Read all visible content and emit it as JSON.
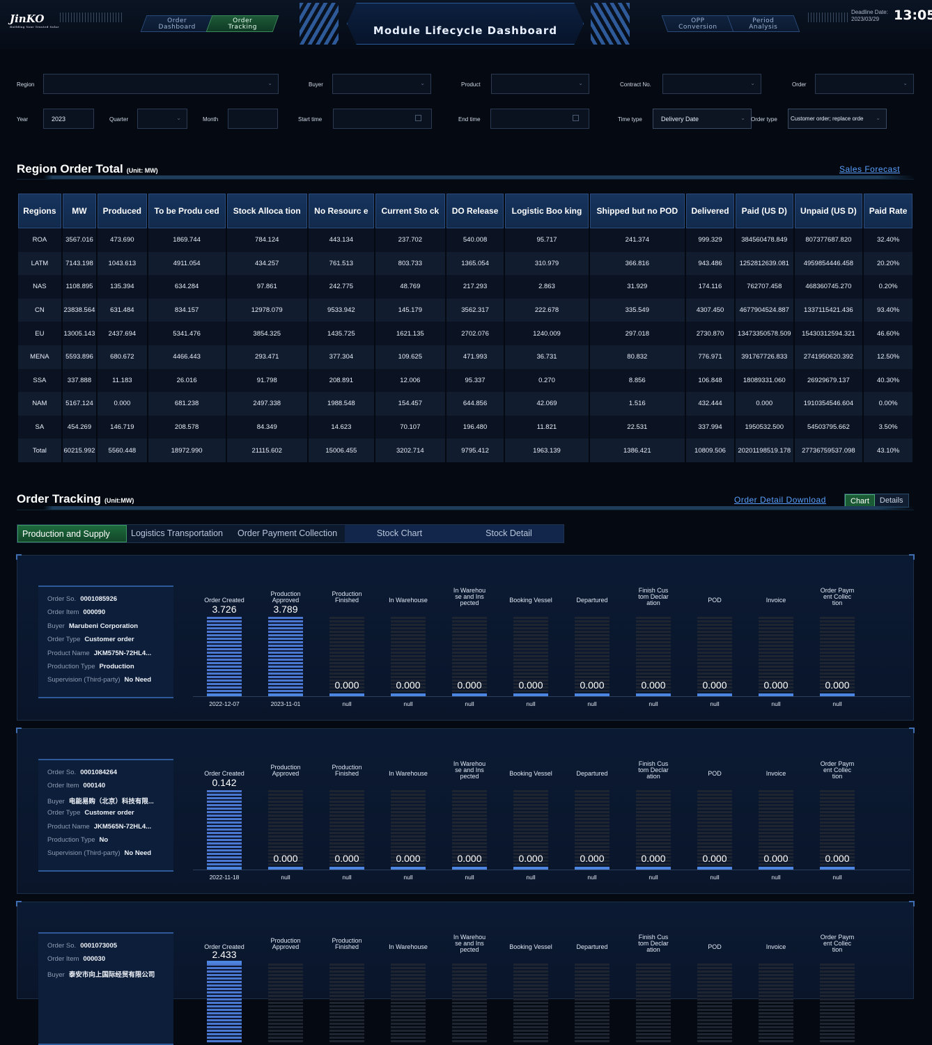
{
  "header": {
    "logo": "JinKO",
    "logo_sub": "Solar",
    "logo_tag": "Building Your Trusted Solar",
    "nav_left": [
      {
        "label": "Order\nDashboard"
      },
      {
        "label": "Order\nTracking"
      }
    ],
    "title": "Module Lifecycle Dashboard",
    "nav_right": [
      {
        "label": "OPP\nConversion"
      },
      {
        "label": "Period\nAnalysis"
      }
    ],
    "deadline_label": "Deadline Date:",
    "deadline_date": "2023/03/29",
    "clock": "13:05"
  },
  "filters": {
    "region_label": "Region",
    "buyer_label": "Buyer",
    "product_label": "Product",
    "contract_label": "Contract No.",
    "order_label": "Order",
    "year_label": "Year",
    "year_value": "2023",
    "quarter_label": "Quarter",
    "month_label": "Month",
    "start_label": "Start time",
    "end_label": "End time",
    "time_type_label": "Time type",
    "time_type_value": "Delivery Date",
    "order_type_label": "Order type",
    "order_type_value": "Customer order; replace orde"
  },
  "region_section": {
    "title": "Region Order Total",
    "unit": "(Unit: MW)",
    "link": "Sales Forecast"
  },
  "region_table": {
    "headers": [
      "Regions",
      "MW",
      "Produced",
      "To be Produ ced",
      "Stock Alloca tion",
      "No Resourc e",
      "Current Sto ck",
      "DO Release",
      "Logistic Boo king",
      "Shipped but no POD",
      "Delivered",
      "Paid  (US D)",
      "Unpaid  (US D)",
      "Paid Rate"
    ],
    "rows": [
      [
        "ROA",
        "3567.016",
        "473.690",
        "1869.744",
        "784.124",
        "443.134",
        "237.702",
        "540.008",
        "95.717",
        "241.374",
        "999.329",
        "384560478.849",
        "807377687.820",
        "32.40%"
      ],
      [
        "LATM",
        "7143.198",
        "1043.613",
        "4911.054",
        "434.257",
        "761.513",
        "803.733",
        "1365.054",
        "310.979",
        "366.816",
        "943.486",
        "1252812639.081",
        "4959854446.458",
        "20.20%"
      ],
      [
        "NAS",
        "1108.895",
        "135.394",
        "634.284",
        "97.861",
        "242.775",
        "48.769",
        "217.293",
        "2.863",
        "31.929",
        "174.116",
        "762707.458",
        "468360745.270",
        "0.20%"
      ],
      [
        "CN",
        "23838.564",
        "631.484",
        "834.157",
        "12978.079",
        "9533.942",
        "145.179",
        "3562.317",
        "222.678",
        "335.549",
        "4307.450",
        "4677904524.887",
        "1337115421.436",
        "93.40%"
      ],
      [
        "EU",
        "13005.143",
        "2437.694",
        "5341.476",
        "3854.325",
        "1435.725",
        "1621.135",
        "2702.076",
        "1240.009",
        "297.018",
        "2730.870",
        "13473350578.509",
        "15430312594.321",
        "46.60%"
      ],
      [
        "MENA",
        "5593.896",
        "680.672",
        "4466.443",
        "293.471",
        "377.304",
        "109.625",
        "471.993",
        "36.731",
        "80.832",
        "776.971",
        "391767726.833",
        "2741950620.392",
        "12.50%"
      ],
      [
        "SSA",
        "337.888",
        "11.183",
        "26.016",
        "91.798",
        "208.891",
        "12.006",
        "95.337",
        "0.270",
        "8.856",
        "106.848",
        "18089331.060",
        "26929679.137",
        "40.30%"
      ],
      [
        "NAM",
        "5167.124",
        "0.000",
        "681.238",
        "2497.338",
        "1988.548",
        "154.457",
        "644.856",
        "42.069",
        "1.516",
        "432.444",
        "0.000",
        "1910354546.604",
        "0.00%"
      ],
      [
        "SA",
        "454.269",
        "146.719",
        "208.578",
        "84.349",
        "14.623",
        "70.107",
        "196.480",
        "11.821",
        "22.531",
        "337.994",
        "1950532.500",
        "54503795.662",
        "3.50%"
      ],
      [
        "Total",
        "60215.992",
        "5560.448",
        "18972.990",
        "21115.602",
        "15006.455",
        "3202.714",
        "9795.412",
        "1963.139",
        "1386.421",
        "10809.506",
        "20201198519.178",
        "27736759537.098",
        "43.10%"
      ]
    ]
  },
  "tracking_section": {
    "title": "Order Tracking",
    "unit": "(Unit:MW)",
    "link": "Order Detail Download",
    "toggle": [
      "Chart",
      "Details"
    ]
  },
  "tracking_tabs": [
    "Production and Supply",
    "Logistics Transportation",
    "Order Payment Collection",
    "Stock Chart",
    "Stock Detail"
  ],
  "stage_labels": [
    "Order Created",
    "Production\nApproved",
    "Production\nFinished",
    "In Warehouse",
    "In Warehou\nse and Ins\npected",
    "Booking Vessel",
    "Departured",
    "Finish Cus\ntom Declar\nation",
    "POD",
    "Invoice",
    "Order Paym\nent Collec\ntion"
  ],
  "info_keys": [
    "Order So.",
    "Order Item",
    "Buyer",
    "Order Type",
    "Product Name",
    "Production Type",
    "Supervision (Third-party)"
  ],
  "orders": [
    {
      "info": [
        "0001085926",
        "000090",
        "Marubeni Corporation",
        "Customer order",
        "JKM575N-72HL4...",
        "Production",
        "No Need"
      ],
      "values": [
        "3.726",
        "3.789",
        "0.000",
        "0.000",
        "0.000",
        "0.000",
        "0.000",
        "0.000",
        "0.000",
        "0.000",
        "0.000"
      ],
      "filled": [
        true,
        true,
        false,
        false,
        false,
        false,
        false,
        false,
        false,
        false,
        false
      ],
      "dates": [
        "2022-12-07",
        "2023-11-01",
        "null",
        "null",
        "null",
        "null",
        "null",
        "null",
        "null",
        "null",
        "null"
      ]
    },
    {
      "info": [
        "0001084264",
        "000140",
        "电能易购（北京）科技有限...",
        "Customer order",
        "JKM565N-72HL4...",
        "No",
        "No Need"
      ],
      "values": [
        "0.142",
        "0.000",
        "0.000",
        "0.000",
        "0.000",
        "0.000",
        "0.000",
        "0.000",
        "0.000",
        "0.000",
        "0.000"
      ],
      "filled": [
        true,
        false,
        false,
        false,
        false,
        false,
        false,
        false,
        false,
        false,
        false
      ],
      "dates": [
        "2022-11-18",
        "null",
        "null",
        "null",
        "null",
        "null",
        "null",
        "null",
        "null",
        "null",
        "null"
      ]
    },
    {
      "info": [
        "0001073005",
        "000030",
        "泰安市向上国际经贸有限公司",
        "",
        "",
        "",
        ""
      ],
      "values": [
        "2.433",
        "",
        "",
        "",
        "",
        "",
        "",
        "",
        "",
        "",
        ""
      ],
      "filled": [
        true,
        false,
        false,
        false,
        false,
        false,
        false,
        false,
        false,
        false,
        false
      ],
      "dates": [
        "",
        "",
        "",
        "",
        "",
        "",
        "",
        "",
        "",
        "",
        ""
      ]
    }
  ]
}
